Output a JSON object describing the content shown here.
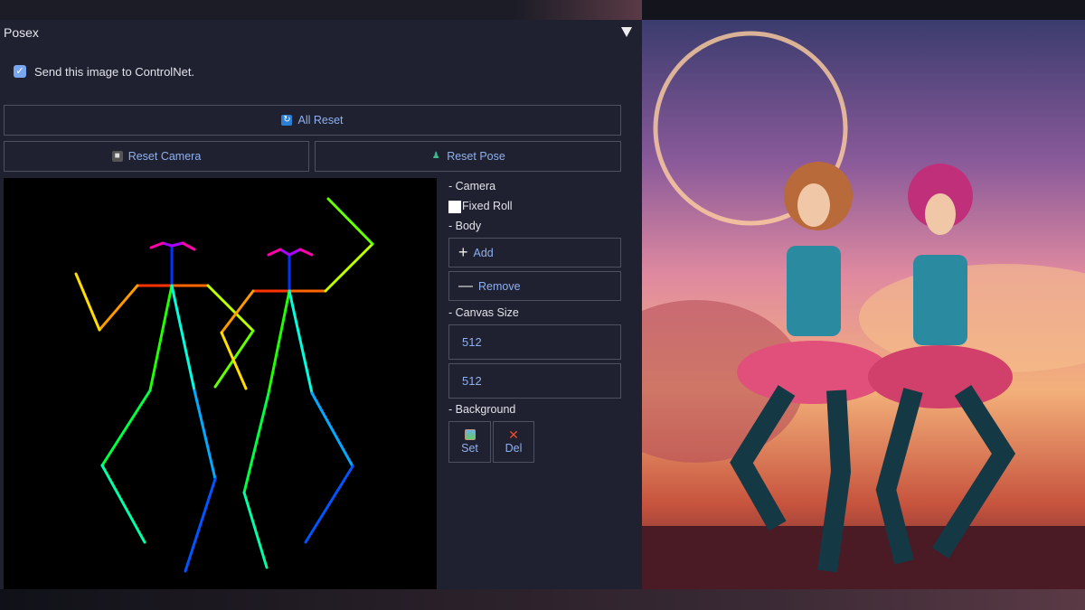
{
  "panel": {
    "title": "Posex",
    "send_checkbox": {
      "label": "Send this image to ControlNet.",
      "checked": true
    }
  },
  "buttons": {
    "all_reset": "All Reset",
    "reset_camera": "Reset Camera",
    "reset_pose": "Reset Pose"
  },
  "sidebar": {
    "camera_label": "- Camera",
    "fixed_roll_label": "Fixed Roll",
    "fixed_roll_checked": false,
    "body_label": "- Body",
    "add": "Add",
    "remove": "Remove",
    "canvas_size_label": "- Canvas Size",
    "width": "512",
    "height": "512",
    "background_label": "- Background",
    "set": "Set",
    "del": "Del"
  },
  "colors": {
    "accent": "#8fb0ee",
    "panel_bg": "#1f2130"
  }
}
